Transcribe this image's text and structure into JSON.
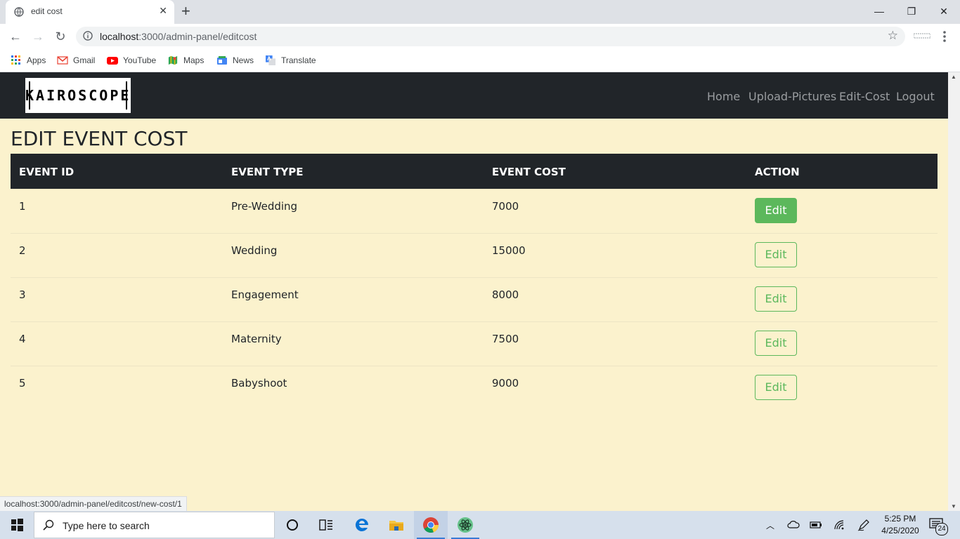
{
  "browser": {
    "tab_title": "edit cost",
    "url_host": "localhost",
    "url_path": ":3000/admin-panel/editcost",
    "bookmarks": [
      {
        "label": "Apps",
        "icon": "apps-grid-icon"
      },
      {
        "label": "Gmail",
        "icon": "gmail-icon"
      },
      {
        "label": "YouTube",
        "icon": "youtube-icon"
      },
      {
        "label": "Maps",
        "icon": "maps-icon"
      },
      {
        "label": "News",
        "icon": "news-icon"
      },
      {
        "label": "Translate",
        "icon": "translate-icon"
      }
    ],
    "status_url": "localhost:3000/admin-panel/editcost/new-cost/1"
  },
  "navbar": {
    "logo_text": "KAIROSCOPE",
    "links": [
      "Home",
      "Upload-Pictures",
      "Edit-Cost",
      "Logout"
    ]
  },
  "page": {
    "heading": "EDIT EVENT COST",
    "columns": [
      "EVENT ID",
      "EVENT TYPE",
      "EVENT COST",
      "ACTION"
    ],
    "rows": [
      {
        "id": "1",
        "type": "Pre-Wedding",
        "cost": "7000",
        "action": "Edit"
      },
      {
        "id": "2",
        "type": "Wedding",
        "cost": "15000",
        "action": "Edit"
      },
      {
        "id": "3",
        "type": "Engagement",
        "cost": "8000",
        "action": "Edit"
      },
      {
        "id": "4",
        "type": "Maternity",
        "cost": "7500",
        "action": "Edit"
      },
      {
        "id": "5",
        "type": "Babyshoot",
        "cost": "9000",
        "action": "Edit"
      }
    ]
  },
  "taskbar": {
    "search_placeholder": "Type here to search",
    "time": "5:25 PM",
    "date": "4/25/2020",
    "notification_count": "24"
  },
  "colors": {
    "page_bg": "#fbf2cd",
    "navbar_bg": "#212529",
    "button_green": "#5cb85c"
  }
}
